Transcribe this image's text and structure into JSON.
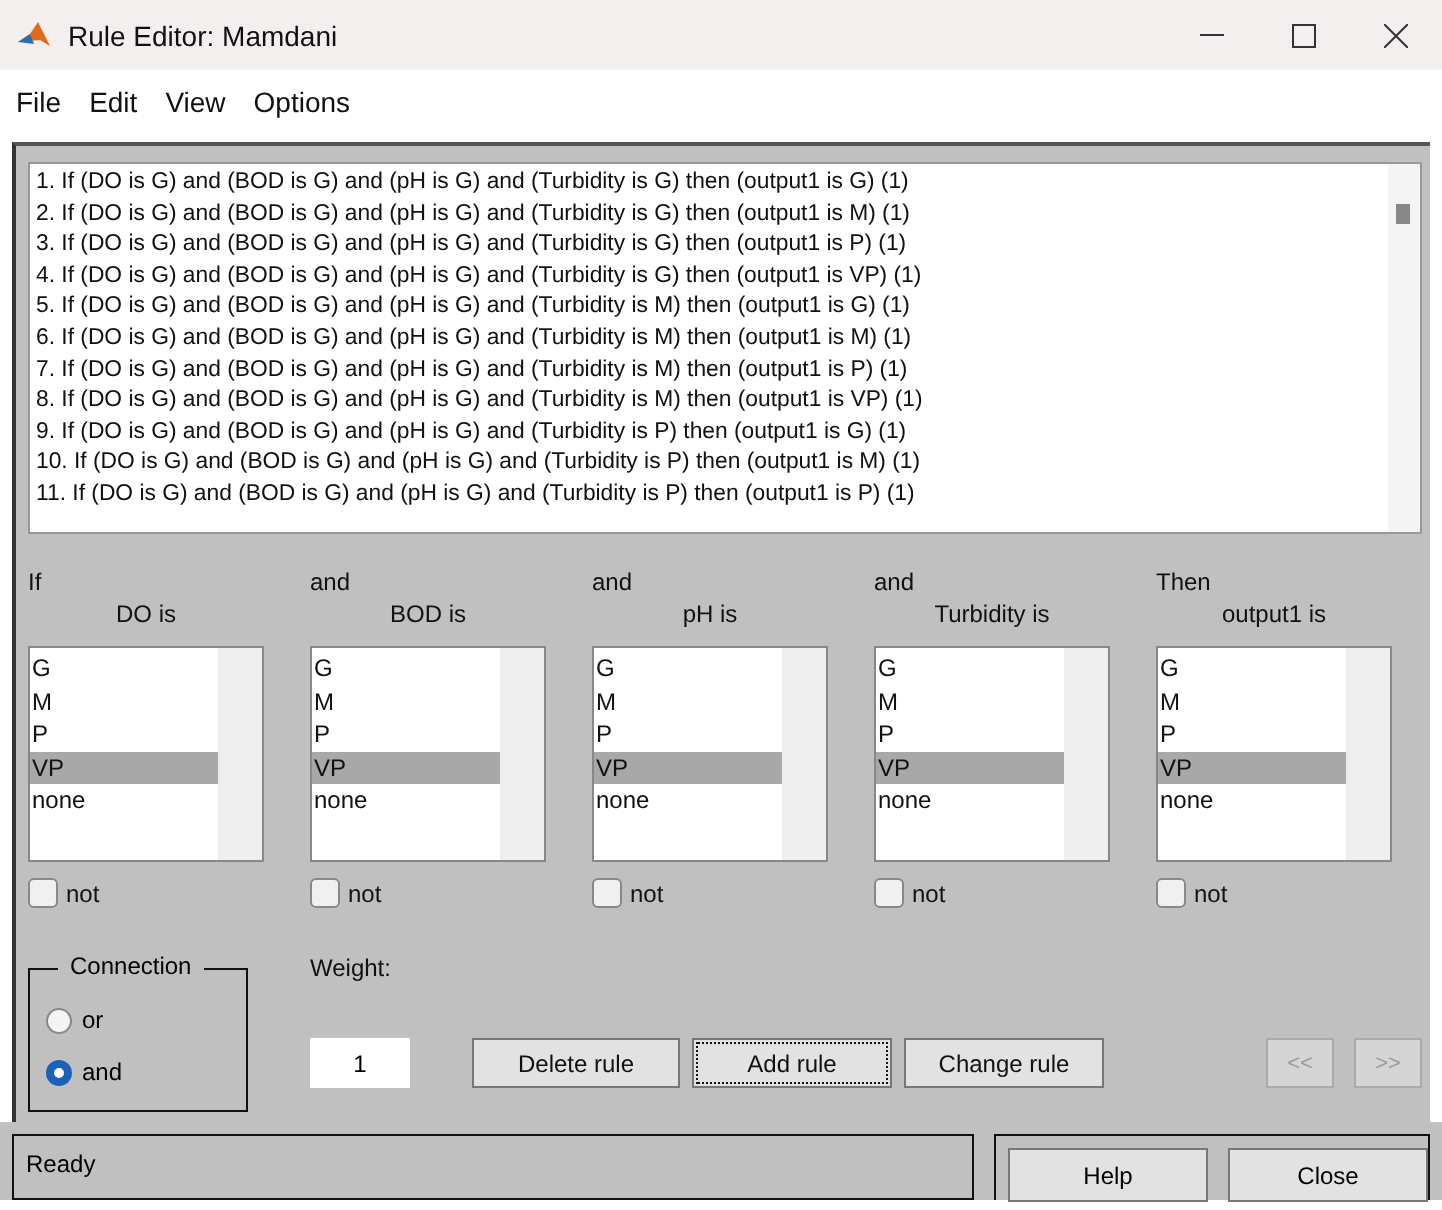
{
  "window": {
    "title": "Rule Editor: Mamdani"
  },
  "menu": [
    "File",
    "Edit",
    "View",
    "Options"
  ],
  "rules": [
    "1. If (DO is G) and (BOD is G) and (pH is G) and (Turbidity is G) then (output1 is G) (1)",
    "2. If (DO is G) and (BOD is G) and (pH is G) and (Turbidity is G) then (output1 is M) (1)",
    "3. If (DO is G) and (BOD is G) and (pH is G) and (Turbidity is G) then (output1 is P) (1)",
    "4. If (DO is G) and (BOD is G) and (pH is G) and (Turbidity is G) then (output1 is VP) (1)",
    "5. If (DO is G) and (BOD is G) and (pH is G) and (Turbidity is M) then (output1 is G) (1)",
    "6. If (DO is G) and (BOD is G) and (pH is G) and (Turbidity is M) then (output1 is M) (1)",
    "7. If (DO is G) and (BOD is G) and (pH is G) and (Turbidity is M) then (output1 is P) (1)",
    "8. If (DO is G) and (BOD is G) and (pH is G) and (Turbidity is M) then (output1 is VP) (1)",
    "9. If (DO is G) and (BOD is G) and (pH is G) and (Turbidity is P) then (output1 is G) (1)",
    "10. If (DO is G) and (BOD is G) and (pH is G) and (Turbidity is P) then (output1 is M) (1)",
    "11. If (DO is G) and (BOD is G) and (pH is G) and (Turbidity is P) then (output1 is P) (1)"
  ],
  "columns": [
    {
      "prefix": "If",
      "label": "DO is",
      "options": [
        {
          "label": "G",
          "selected": false
        },
        {
          "label": "M",
          "selected": false
        },
        {
          "label": "P",
          "selected": false
        },
        {
          "label": "VP",
          "selected": true
        },
        {
          "label": "none",
          "selected": false
        }
      ],
      "not_label": "not",
      "not_checked": false
    },
    {
      "prefix": "and",
      "label": "BOD is",
      "options": [
        {
          "label": "G",
          "selected": false
        },
        {
          "label": "M",
          "selected": false
        },
        {
          "label": "P",
          "selected": false
        },
        {
          "label": "VP",
          "selected": true
        },
        {
          "label": "none",
          "selected": false
        }
      ],
      "not_label": "not",
      "not_checked": false
    },
    {
      "prefix": "and",
      "label": "pH is",
      "options": [
        {
          "label": "G",
          "selected": false
        },
        {
          "label": "M",
          "selected": false
        },
        {
          "label": "P",
          "selected": false
        },
        {
          "label": "VP",
          "selected": true
        },
        {
          "label": "none",
          "selected": false
        }
      ],
      "not_label": "not",
      "not_checked": false
    },
    {
      "prefix": "and",
      "label": "Turbidity is",
      "options": [
        {
          "label": "G",
          "selected": false
        },
        {
          "label": "M",
          "selected": false
        },
        {
          "label": "P",
          "selected": false
        },
        {
          "label": "VP",
          "selected": true
        },
        {
          "label": "none",
          "selected": false
        }
      ],
      "not_label": "not",
      "not_checked": false
    },
    {
      "prefix": "Then",
      "label": "output1 is",
      "options": [
        {
          "label": "G",
          "selected": false
        },
        {
          "label": "M",
          "selected": false
        },
        {
          "label": "P",
          "selected": false
        },
        {
          "label": "VP",
          "selected": true
        },
        {
          "label": "none",
          "selected": false
        }
      ],
      "not_label": "not",
      "not_checked": false
    }
  ],
  "connection": {
    "title": "Connection",
    "options": [
      {
        "label": "or",
        "selected": false
      },
      {
        "label": "and",
        "selected": true
      }
    ]
  },
  "weight": {
    "label": "Weight:",
    "value": "1"
  },
  "buttons": [
    {
      "label": "Delete rule",
      "focused": false
    },
    {
      "label": "Add rule",
      "focused": true
    },
    {
      "label": "Change rule",
      "focused": false
    }
  ],
  "nav": [
    {
      "label": "<<",
      "disabled": true
    },
    {
      "label": ">>",
      "disabled": true
    }
  ],
  "status_bar": {
    "text": "Ready"
  },
  "footer_buttons": [
    "Help",
    "Close"
  ]
}
